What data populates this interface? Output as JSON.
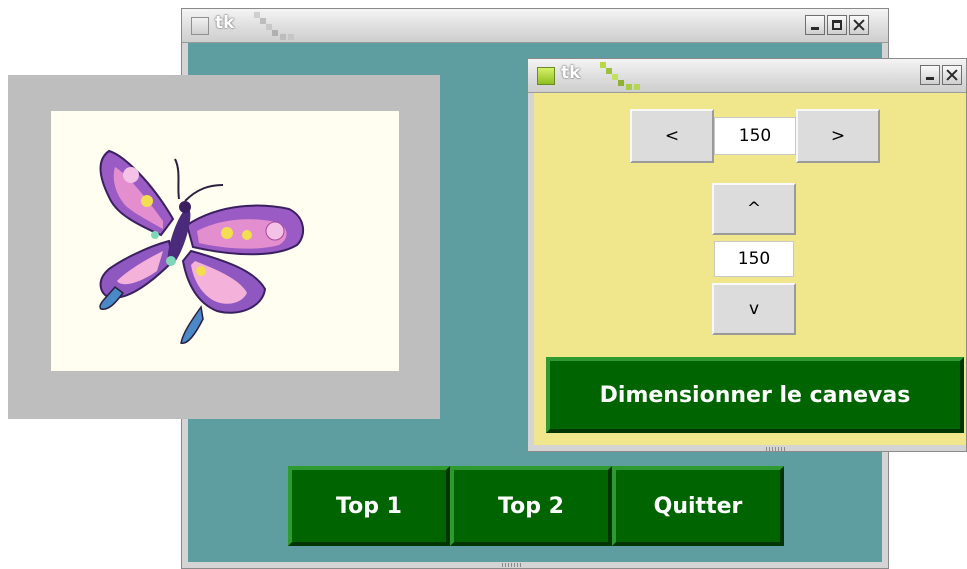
{
  "main_window": {
    "title": "tk",
    "buttons": {
      "top1": "Top 1",
      "top2": "Top 2",
      "quit": "Quitter"
    }
  },
  "canvas": {
    "image": "butterfly-image",
    "background": "#fffef0",
    "frame_color": "#bebebe"
  },
  "resize_window": {
    "title": "tk",
    "width_controls": {
      "decrease": "<",
      "value": "150",
      "increase": ">"
    },
    "height_controls": {
      "increase": "^",
      "value": "150",
      "decrease": "v"
    },
    "apply_button": "Dimensionner le canevas"
  },
  "colors": {
    "main_client": "#5f9ea0",
    "resize_client": "#f0e68c",
    "button_green": "#006400"
  }
}
